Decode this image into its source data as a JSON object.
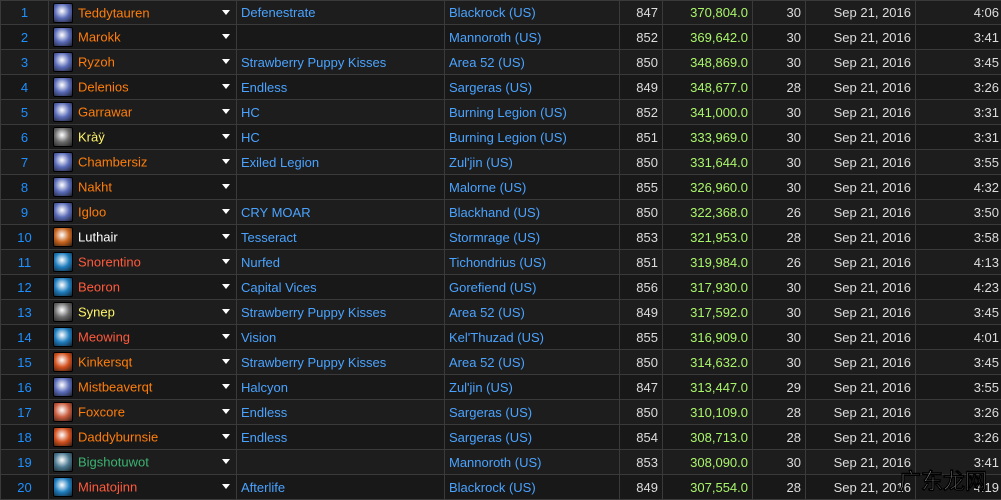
{
  "colors": {
    "rank": "#1e90ff",
    "link": "#4aa3ff",
    "score": "#a9f56b",
    "text": "#dddddd"
  },
  "rows": [
    {
      "rank": "1",
      "name": "Teddytauren",
      "class_color": "#ff7d0a",
      "icon": "druid-icon",
      "icon_color": "#5a6bb8",
      "guild": "Defenestrate",
      "realm": "Blackrock (US)",
      "ilvl": "847",
      "score": "370,804.0",
      "keys": "30",
      "date": "Sep 21, 2016",
      "time": "4:06"
    },
    {
      "rank": "2",
      "name": "Marokk",
      "class_color": "#ff7d0a",
      "icon": "druid-icon",
      "icon_color": "#5a6bb8",
      "guild": "",
      "realm": "Mannoroth (US)",
      "ilvl": "852",
      "score": "369,642.0",
      "keys": "30",
      "date": "Sep 21, 2016",
      "time": "3:41"
    },
    {
      "rank": "3",
      "name": "Ryzoh",
      "class_color": "#ff7d0a",
      "icon": "druid-icon",
      "icon_color": "#5a6bb8",
      "guild": "Strawberry Puppy Kisses",
      "realm": "Area 52 (US)",
      "ilvl": "850",
      "score": "348,869.0",
      "keys": "30",
      "date": "Sep 21, 2016",
      "time": "3:45"
    },
    {
      "rank": "4",
      "name": "Delenios",
      "class_color": "#ff7d0a",
      "icon": "druid-icon",
      "icon_color": "#5a6bb8",
      "guild": "Endless",
      "realm": "Sargeras (US)",
      "ilvl": "849",
      "score": "348,677.0",
      "keys": "28",
      "date": "Sep 21, 2016",
      "time": "3:26"
    },
    {
      "rank": "5",
      "name": "Garrawar",
      "class_color": "#ff7d0a",
      "icon": "druid-icon",
      "icon_color": "#5a6bb8",
      "guild": "HC",
      "realm": "Burning Legion (US)",
      "ilvl": "852",
      "score": "341,000.0",
      "keys": "30",
      "date": "Sep 21, 2016",
      "time": "3:31"
    },
    {
      "rank": "6",
      "name": "Kràÿ",
      "class_color": "#fff569",
      "icon": "rogue-icon",
      "icon_color": "#6a6a6a",
      "guild": "HC",
      "realm": "Burning Legion (US)",
      "ilvl": "851",
      "score": "333,969.0",
      "keys": "30",
      "date": "Sep 21, 2016",
      "time": "3:31"
    },
    {
      "rank": "7",
      "name": "Chambersiz",
      "class_color": "#ff7d0a",
      "icon": "druid-icon",
      "icon_color": "#5a6bb8",
      "guild": "Exiled Legion",
      "realm": "Zul'jin (US)",
      "ilvl": "850",
      "score": "331,644.0",
      "keys": "30",
      "date": "Sep 21, 2016",
      "time": "3:55"
    },
    {
      "rank": "8",
      "name": "Nakht",
      "class_color": "#ff7d0a",
      "icon": "druid-icon",
      "icon_color": "#5a6bb8",
      "guild": "",
      "realm": "Malorne (US)",
      "ilvl": "855",
      "score": "326,960.0",
      "keys": "30",
      "date": "Sep 21, 2016",
      "time": "4:32"
    },
    {
      "rank": "9",
      "name": "Igloo",
      "class_color": "#ff7d0a",
      "icon": "druid-icon",
      "icon_color": "#5a6bb8",
      "guild": "CRY MOAR",
      "realm": "Blackhand (US)",
      "ilvl": "850",
      "score": "322,368.0",
      "keys": "26",
      "date": "Sep 21, 2016",
      "time": "3:50"
    },
    {
      "rank": "10",
      "name": "Luthair",
      "class_color": "#ffffff",
      "icon": "priest-icon",
      "icon_color": "#c8641e",
      "guild": "Tesseract",
      "realm": "Stormrage (US)",
      "ilvl": "853",
      "score": "321,953.0",
      "keys": "28",
      "date": "Sep 21, 2016",
      "time": "3:58"
    },
    {
      "rank": "11",
      "name": "Snorentino",
      "class_color": "#ff5a3c",
      "icon": "hunter-icon",
      "icon_color": "#1e7dbe",
      "guild": "Nurfed",
      "realm": "Tichondrius (US)",
      "ilvl": "851",
      "score": "319,984.0",
      "keys": "26",
      "date": "Sep 21, 2016",
      "time": "4:13"
    },
    {
      "rank": "12",
      "name": "Beoron",
      "class_color": "#ff5a3c",
      "icon": "hunter-icon",
      "icon_color": "#1e7dbe",
      "guild": "Capital Vices",
      "realm": "Gorefiend (US)",
      "ilvl": "856",
      "score": "317,930.0",
      "keys": "30",
      "date": "Sep 21, 2016",
      "time": "4:23"
    },
    {
      "rank": "13",
      "name": "Synep",
      "class_color": "#fff569",
      "icon": "rogue-icon",
      "icon_color": "#6a6a6a",
      "guild": "Strawberry Puppy Kisses",
      "realm": "Area 52 (US)",
      "ilvl": "849",
      "score": "317,592.0",
      "keys": "30",
      "date": "Sep 21, 2016",
      "time": "3:45"
    },
    {
      "rank": "14",
      "name": "Meowing",
      "class_color": "#ff5a3c",
      "icon": "hunter-icon",
      "icon_color": "#1e7dbe",
      "guild": "Vision",
      "realm": "Kel'Thuzad (US)",
      "ilvl": "855",
      "score": "316,909.0",
      "keys": "30",
      "date": "Sep 21, 2016",
      "time": "4:01"
    },
    {
      "rank": "15",
      "name": "Kinkersqt",
      "class_color": "#ff7d0a",
      "icon": "fire-icon",
      "icon_color": "#d2501e",
      "guild": "Strawberry Puppy Kisses",
      "realm": "Area 52 (US)",
      "ilvl": "850",
      "score": "314,632.0",
      "keys": "30",
      "date": "Sep 21, 2016",
      "time": "3:45"
    },
    {
      "rank": "16",
      "name": "Mistbeaverqt",
      "class_color": "#ff7d0a",
      "icon": "druid-icon",
      "icon_color": "#5a6bb8",
      "guild": "Halcyon",
      "realm": "Zul'jin (US)",
      "ilvl": "847",
      "score": "313,447.0",
      "keys": "29",
      "date": "Sep 21, 2016",
      "time": "3:55"
    },
    {
      "rank": "17",
      "name": "Foxcore",
      "class_color": "#ff7d0a",
      "icon": "paw-icon",
      "icon_color": "#c85a3c",
      "guild": "Endless",
      "realm": "Sargeras (US)",
      "ilvl": "850",
      "score": "310,109.0",
      "keys": "28",
      "date": "Sep 21, 2016",
      "time": "3:26"
    },
    {
      "rank": "18",
      "name": "Daddyburnsie",
      "class_color": "#ff7d0a",
      "icon": "fire-icon",
      "icon_color": "#d2501e",
      "guild": "Endless",
      "realm": "Sargeras (US)",
      "ilvl": "854",
      "score": "308,713.0",
      "keys": "28",
      "date": "Sep 21, 2016",
      "time": "3:26"
    },
    {
      "rank": "19",
      "name": "Bigshotuwot",
      "class_color": "#3cb371",
      "icon": "monk-icon",
      "icon_color": "#4a7890",
      "guild": "",
      "realm": "Mannoroth (US)",
      "ilvl": "853",
      "score": "308,090.0",
      "keys": "30",
      "date": "Sep 21, 2016",
      "time": "3:41"
    },
    {
      "rank": "20",
      "name": "Minatojinn",
      "class_color": "#ff5a3c",
      "icon": "hunter-icon",
      "icon_color": "#1e7dbe",
      "guild": "Afterlife",
      "realm": "Blackrock (US)",
      "ilvl": "849",
      "score": "307,554.0",
      "keys": "28",
      "date": "Sep 21, 2016",
      "time": "4:19"
    }
  ],
  "watermark": {
    "text": "广东龙网",
    "icon": "watermark-logo-icon"
  }
}
